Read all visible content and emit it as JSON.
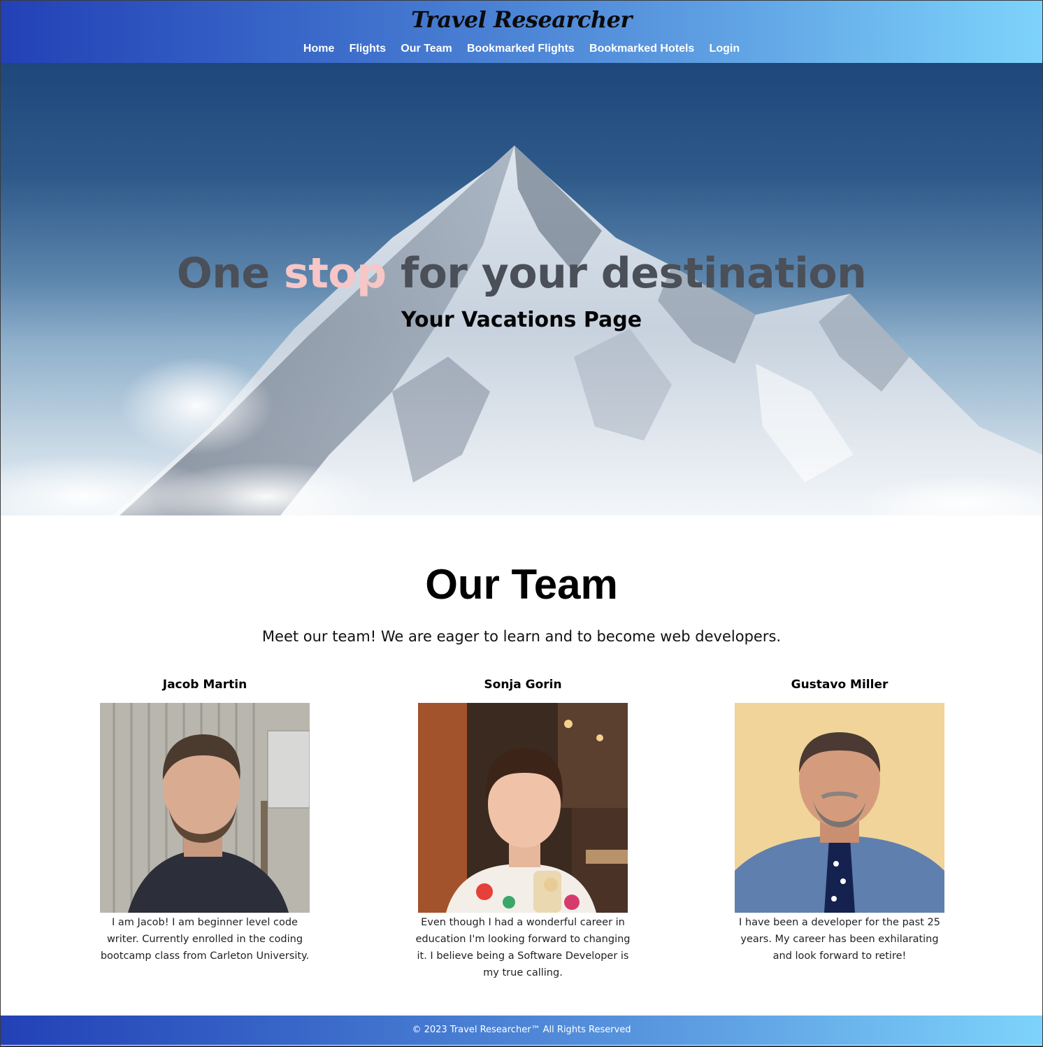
{
  "header": {
    "brand": "Travel Researcher",
    "nav": [
      "Home",
      "Flights",
      "Our Team",
      "Bookmarked Flights",
      "Bookmarked Hotels",
      "Login"
    ]
  },
  "hero": {
    "title_part1": "One ",
    "title_accent": "stop",
    "title_part2": " for your destination",
    "subtitle": "Your Vacations Page"
  },
  "team": {
    "title": "Our Team",
    "intro": "Meet our team! We are eager to learn and to become web developers.",
    "members": [
      {
        "name": "Jacob Martin",
        "bio": "I am Jacob! I am beginner level code writer. Currently enrolled in the coding bootcamp class from Carleton University."
      },
      {
        "name": "Sonja Gorin",
        "bio": "Even though I had a wonderful career in education I'm looking forward to changing it. I believe being a Software Developer is my true calling."
      },
      {
        "name": "Gustavo Miller",
        "bio": "I have been a developer for the past 25 years. My career has been exhilarating and look forward to retire!"
      }
    ]
  },
  "footer": {
    "text": "© 2023 Travel Researcher™ All Rights Reserved"
  },
  "colors": {
    "header_gradient_start": "#2241b6",
    "header_gradient_end": "#7dd3fb",
    "hero_title": "#4a4f58",
    "hero_accent": "#f7c6c6"
  }
}
